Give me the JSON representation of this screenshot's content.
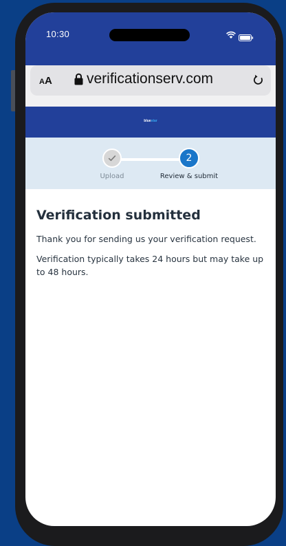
{
  "status_bar": {
    "time": "10:30"
  },
  "browser": {
    "text_size_label_small": "A",
    "text_size_label_big": "A",
    "url": "verificationserv.com"
  },
  "site": {
    "logo_main": "blue",
    "logo_accent": "star"
  },
  "stepper": {
    "steps": [
      {
        "label": "Upload",
        "state": "complete"
      },
      {
        "label": "Review & submit",
        "number": "2",
        "state": "current"
      }
    ]
  },
  "content": {
    "title": "Verification submitted",
    "paragraphs": [
      "Thank you for sending us your verification request.",
      "Verification typically takes 24 hours but may take up to 48 hours."
    ]
  },
  "colors": {
    "background": "#0a3f86",
    "brand_header": "#22409a",
    "stepper_bg": "#dde9f3",
    "step_active": "#1a76c9",
    "logo_accent": "#37a8f0"
  }
}
